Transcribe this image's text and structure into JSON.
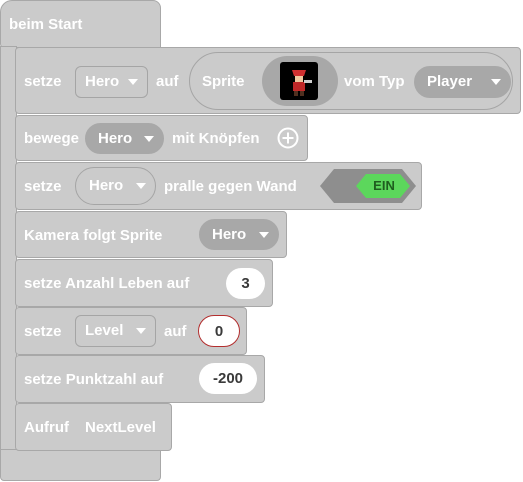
{
  "hat": {
    "label": "beim Start"
  },
  "blocks": {
    "set_sprite": {
      "set_label": "setze",
      "var": "Hero",
      "on_label": "auf",
      "sprite_label": "Sprite",
      "type_label": "vom Typ",
      "type_value": "Player",
      "sprite_image_icon": "hero-sprite-icon"
    },
    "move": {
      "label": "bewege",
      "var": "Hero",
      "buttons_label": "mit Knöpfen",
      "plus_icon": "plus-circle-icon"
    },
    "bounce": {
      "set_label": "setze",
      "var": "Hero",
      "wall_label": "pralle gegen Wand",
      "toggle_value": "EIN",
      "toggle_color": "#5cd75c"
    },
    "camera": {
      "label": "Kamera folgt Sprite",
      "var": "Hero"
    },
    "lives": {
      "label": "setze Anzahl Leben auf",
      "value": "3"
    },
    "level": {
      "set_label": "setze",
      "var": "Level",
      "on_label": "auf",
      "value": "0",
      "value_border": "#b32e2e"
    },
    "score": {
      "label": "setze Punktzahl auf",
      "value": "-200"
    },
    "call": {
      "label": "Aufruf",
      "function": "NextLevel"
    }
  }
}
